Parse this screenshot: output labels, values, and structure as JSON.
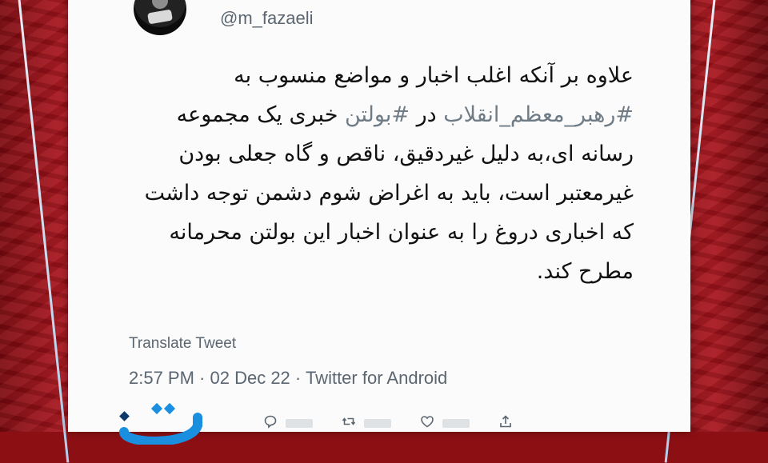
{
  "tweet": {
    "handle": "@m_fazaeli",
    "text_segments": [
      {
        "text": "علاوه بر آنکه اغلب اخبار و مواضع منسوب به ",
        "hl": false
      },
      {
        "text": "#رهبر_معظم_انقلاب",
        "hl": true
      },
      {
        "text": " در ",
        "hl": false
      },
      {
        "text": "#بولتن",
        "hl": true
      },
      {
        "text": " خبری یک مجموعه رسانه ای،به دلیل غیردقیق، ناقص و گاه جعلی بودن غیرمعتبر است، باید به اغراض شوم دشمن توجه داشت که اخباری دروغ را به عنوان اخبار این بولتن محرمانه مطرح کند.",
        "hl": false
      }
    ],
    "translate_label": "Translate Tweet",
    "time": "2:57 PM",
    "date": "02 Dec 22",
    "source": "Twitter for Android",
    "separator": " · "
  },
  "actions": [
    {
      "icon": "reply-icon"
    },
    {
      "icon": "retweet-icon"
    },
    {
      "icon": "like-icon"
    },
    {
      "icon": "share-icon"
    }
  ],
  "colors": {
    "background": "#8c0f14",
    "card": "#fbfbfc",
    "text": "#111111",
    "secondary": "#5b6670",
    "hashtag": "#6f7c86",
    "logo": "#1a8fe0"
  }
}
